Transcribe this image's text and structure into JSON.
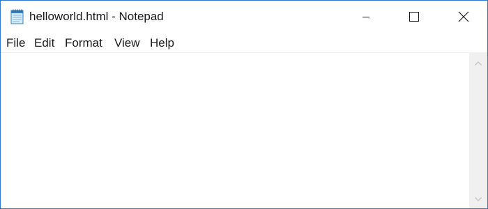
{
  "window": {
    "title": "helloworld.html - Notepad",
    "app_icon": "notepad-icon",
    "accent_border": "#2b79d0",
    "controls": {
      "minimize": "minimize-icon",
      "maximize": "maximize-icon",
      "close": "close-icon"
    }
  },
  "menu": {
    "items": [
      {
        "label": "File"
      },
      {
        "label": "Edit"
      },
      {
        "label": "Format"
      },
      {
        "label": "View"
      },
      {
        "label": "Help"
      }
    ]
  },
  "editor": {
    "content": ""
  },
  "scrollbar": {
    "up_icon": "chevron-up-icon",
    "down_icon": "chevron-down-icon"
  }
}
